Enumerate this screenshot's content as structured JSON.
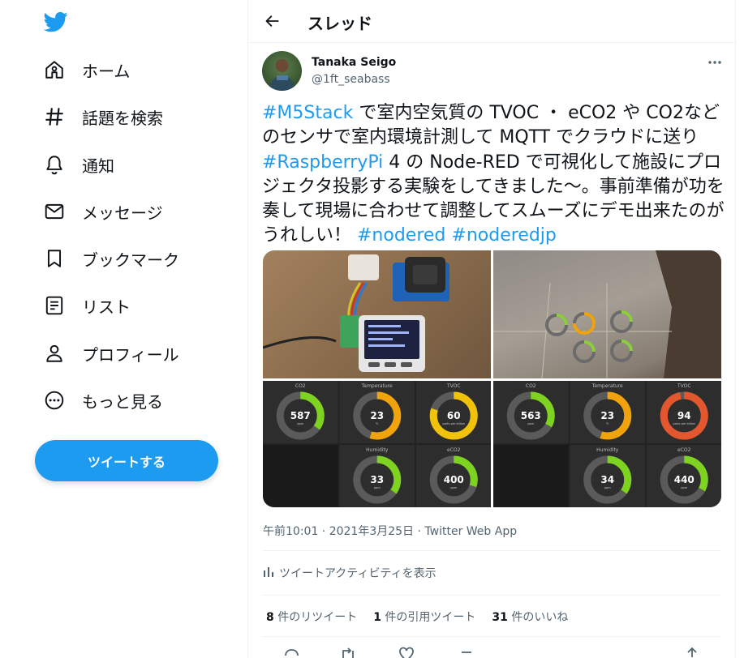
{
  "sidebar": {
    "items": [
      {
        "label": "ホーム",
        "icon": "home-icon"
      },
      {
        "label": "話題を検索",
        "icon": "hashtag-icon"
      },
      {
        "label": "通知",
        "icon": "bell-icon"
      },
      {
        "label": "メッセージ",
        "icon": "mail-icon"
      },
      {
        "label": "ブックマーク",
        "icon": "bookmark-icon"
      },
      {
        "label": "リスト",
        "icon": "list-icon"
      },
      {
        "label": "プロフィール",
        "icon": "profile-icon"
      },
      {
        "label": "もっと見る",
        "icon": "more-circle-icon"
      }
    ],
    "tweet_button": "ツイートする"
  },
  "header": {
    "title": "スレッド"
  },
  "tweet": {
    "user_name": "Tanaka Seigo",
    "handle": "@1ft_seabass",
    "text": [
      {
        "t": "#M5Stack",
        "tag": true
      },
      {
        "t": " で室内空気質の TVOC ・ eCO2 や CO2などのセンサで室内環境計測して MQTT でクラウドに送り ",
        "tag": false
      },
      {
        "t": "#RaspberryPi",
        "tag": true
      },
      {
        "t": " 4 の Node-RED で可視化して施設にプロジェクタ投影する実験をしてきました～。事前準備が功を奏して現場に合わせて調整してスムーズにデモ出来たのがうれしい！ ",
        "tag": false
      },
      {
        "t": "#nodered",
        "tag": true
      },
      {
        "t": " ",
        "tag": false
      },
      {
        "t": "#noderedjp",
        "tag": true
      }
    ],
    "meta": "午前10:01 · 2021年3月25日 · Twitter Web App",
    "activity": "ツイートアクティビティを表示",
    "stats": {
      "retweets_count": "8",
      "retweets_label": " 件のリツイート",
      "quotes_count": "1",
      "quotes_label": " 件の引用ツイート",
      "likes_count": "31",
      "likes_label": " 件のいいね"
    },
    "colors": {
      "accent": "#1d9bf0",
      "text": "#0f1419",
      "muted": "#536471"
    }
  },
  "dashboards": [
    {
      "gauges": [
        {
          "title": "CO2",
          "value": "587",
          "unit": "ppm",
          "fill": 0.35,
          "color": "#7ed321"
        },
        {
          "title": "Temperature",
          "value": "23",
          "unit": "℃",
          "fill": 0.55,
          "color": "#f0a30a"
        },
        {
          "title": "TVOC",
          "value": "60",
          "unit": "parts per billion",
          "fill": 0.8,
          "color": "#f0c20a"
        },
        {
          "title": "",
          "value": "",
          "unit": "",
          "fill": 0,
          "color": ""
        },
        {
          "title": "Humidity",
          "value": "33",
          "unit": "ppm",
          "fill": 0.35,
          "color": "#7ed321"
        },
        {
          "title": "eCO2",
          "value": "400",
          "unit": "ppm",
          "fill": 0.3,
          "color": "#7ed321"
        }
      ]
    },
    {
      "gauges": [
        {
          "title": "CO2",
          "value": "563",
          "unit": "ppm",
          "fill": 0.33,
          "color": "#7ed321"
        },
        {
          "title": "Temperature",
          "value": "23",
          "unit": "℃",
          "fill": 0.55,
          "color": "#f0a30a"
        },
        {
          "title": "TVOC",
          "value": "94",
          "unit": "parts per billion",
          "fill": 0.97,
          "color": "#e4572e"
        },
        {
          "title": "",
          "value": "",
          "unit": "",
          "fill": 0,
          "color": ""
        },
        {
          "title": "Humidity",
          "value": "34",
          "unit": "ppm",
          "fill": 0.35,
          "color": "#7ed321"
        },
        {
          "title": "eCO2",
          "value": "440",
          "unit": "ppm",
          "fill": 0.33,
          "color": "#7ed321"
        }
      ]
    }
  ]
}
